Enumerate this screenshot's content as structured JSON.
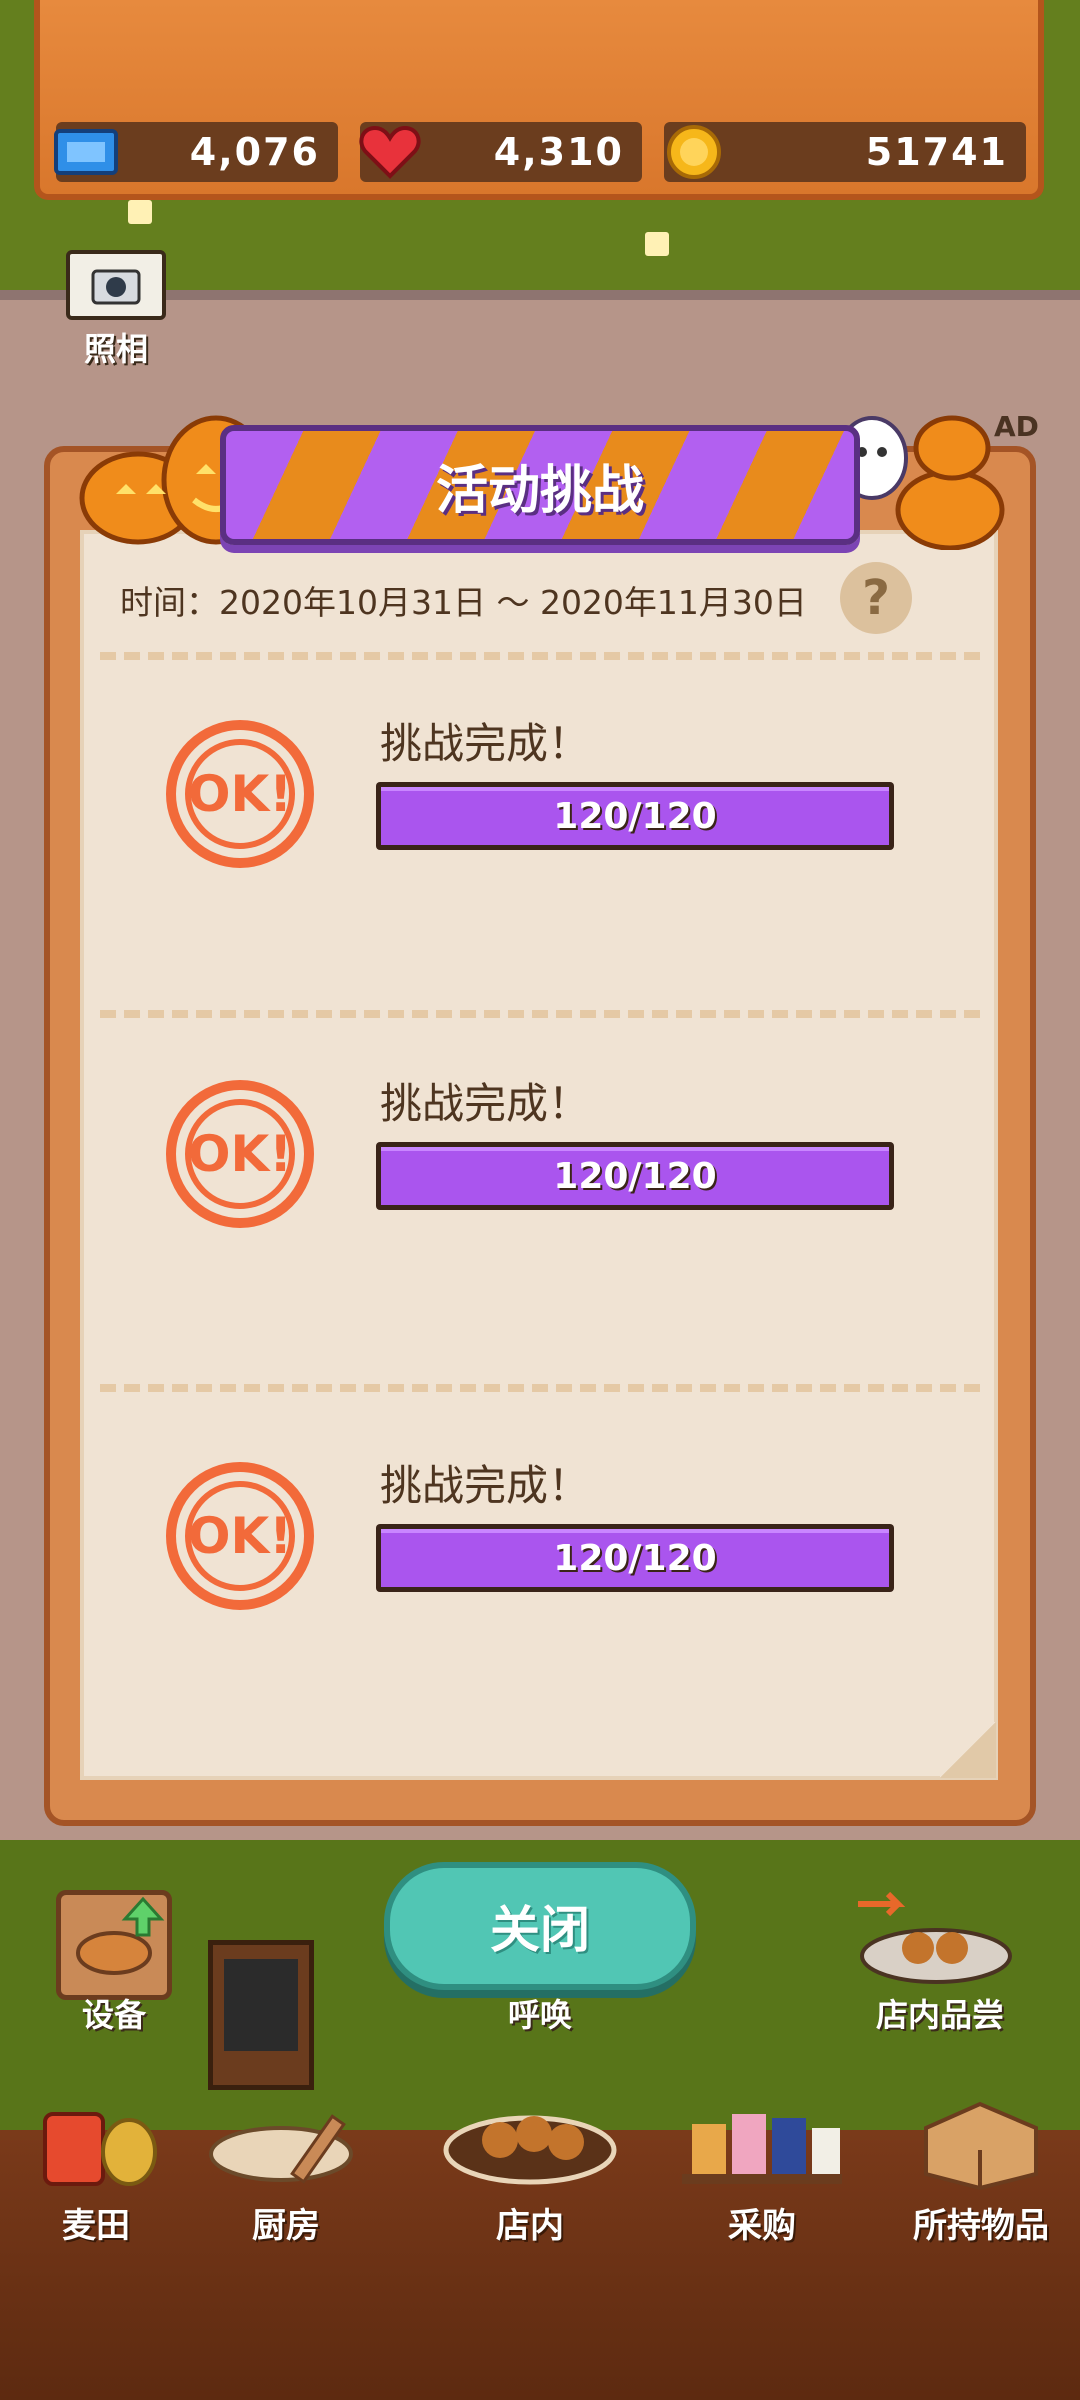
{
  "resources": {
    "tickets": "4,076",
    "hearts": "4,310",
    "coins": "51741"
  },
  "top_left": {
    "camera_label": "照相"
  },
  "side_badge": "AD",
  "event": {
    "title": "活动挑战",
    "date_range": "时间：2020年10月31日 ～ 2020年11月30日",
    "help_symbol": "?"
  },
  "challenges": [
    {
      "status": "挑战完成！",
      "stamp": "OK!",
      "progress_text": "120/120",
      "progress_fraction": 1.0
    },
    {
      "status": "挑战完成！",
      "stamp": "OK!",
      "progress_text": "120/120",
      "progress_fraction": 1.0
    },
    {
      "status": "挑战完成！",
      "stamp": "OK!",
      "progress_text": "120/120",
      "progress_fraction": 1.0
    }
  ],
  "close_button": "关闭",
  "shop_actions": {
    "equipment": "设备",
    "call": "呼唤",
    "tasting": "店内品尝"
  },
  "bottom_nav": [
    {
      "label": "麦田",
      "icon": "wheat-field-icon"
    },
    {
      "label": "厨房",
      "icon": "kitchen-icon"
    },
    {
      "label": "店内",
      "icon": "shop-icon"
    },
    {
      "label": "采购",
      "icon": "purchase-icon"
    },
    {
      "label": "所持物品",
      "icon": "inventory-icon"
    }
  ],
  "colors": {
    "accent_purple": "#aa55ee",
    "accent_orange": "#e88b1c",
    "stamp_red": "#f26a3a",
    "close_teal": "#51c6b4"
  }
}
